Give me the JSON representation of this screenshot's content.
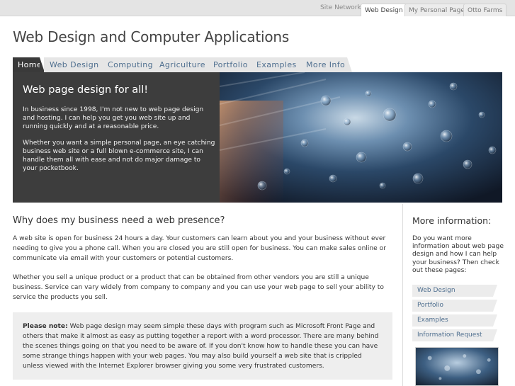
{
  "network": {
    "label": "Site Network:",
    "links": [
      "Web Design",
      "My Personal Page",
      "Otto Farms"
    ]
  },
  "site_title": "Web Design and Computer Applications",
  "tabs": [
    "Home",
    "Web Design",
    "Computing",
    "Agriculture",
    "Portfolio",
    "Examples",
    "More Info"
  ],
  "hero": {
    "heading": "Web page design for all!",
    "para1": "In business since 1998, I'm not new to web page design and hosting. I can help you get you web site up and running quickly and at a reasonable price.",
    "para2": "Whether you want a simple personal page, an eye catching business web site or a full blown e-commerce site, I can handle them all with ease and not do major damage to your pocketbook."
  },
  "main": {
    "heading": "Why does my business need a web presence?",
    "para1": "A web site is open for business 24 hours a day. Your customers can learn about you and your business without ever needing to give you a phone call. When you are closed you are still open for business. You can make sales online or communicate via email with your customers or potential customers.",
    "para2": "Whether you sell a unique product or a product that can be obtained from other vendors you are still a unique business. Service can vary widely from company to company and you can use your web page to sell your ability to service the products you sell.",
    "note_label": "Please note:",
    "note_text": " Web page design may seem simple these days with program such as Microsoft Front Page and others that make it almost as easy as putting together a report with a word processor. There are many behind the scenes things going on that you need to be aware of. If you don't know how to handle these you can have some strange things happen with your web pages. You may also build yourself a web site that is crippled unless viewed with the Internet Explorer browser giving you some very frustrated customers."
  },
  "sidebar": {
    "heading": "More information:",
    "intro": "Do you want more information about web page design and how I can help your business? Then check out these pages:",
    "links": [
      "Web Design",
      "Portfolio",
      "Examples",
      "Information Request"
    ]
  },
  "colors": {
    "tab_active": "#3a3a3a",
    "link": "#4f6f8f",
    "hero_panel": "#3d3d3d"
  }
}
